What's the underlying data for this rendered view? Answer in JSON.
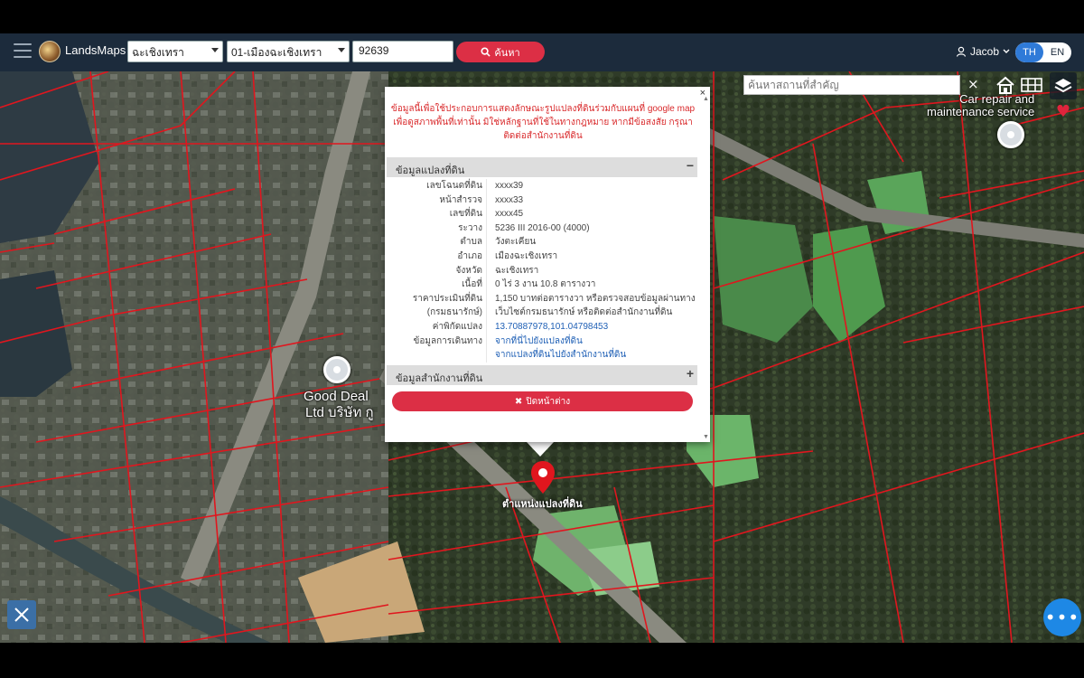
{
  "header": {
    "brand": "LandsMaps",
    "province_select": "ฉะเชิงเทรา",
    "district_select": "01-เมืองฉะเชิงเทรา",
    "parcel_number": "92639",
    "search_label": "ค้นหา",
    "user_name": "Jacob",
    "lang_th": "TH",
    "lang_en": "EN"
  },
  "map": {
    "place_search_placeholder": "ค้นหาสถานที่สำคัญ",
    "poi_top_right": "Car repair and\nmaintenance service",
    "poi_left_line1": "Good Deal",
    "poi_left_line2": "Ltd บริษัท กู",
    "marker_label": "ตำแหน่งแปลงที่ดิน"
  },
  "popup": {
    "notice": "ข้อมูลนี้เพื่อใช้ประกอบการแสดงลักษณะรูปแปลงที่ดินร่วมกับแผนที่ google map เพื่อดูสภาพพื้นที่เท่านั้น มิใช่หลักฐานที่ใช้ในทางกฎหมาย หากมีข้อสงสัย กรุณาติดต่อสำนักงานที่ดิน",
    "section1_title": "ข้อมูลแปลงที่ดิน",
    "section1_sign": "−",
    "rows": [
      {
        "label": "เลขโฉนดที่ดิน",
        "value": "xxxx39",
        "link": false
      },
      {
        "label": "หน้าสำรวจ",
        "value": "xxxx33",
        "link": false
      },
      {
        "label": "เลขที่ดิน",
        "value": "xxxx45",
        "link": false
      },
      {
        "label": "ระวาง",
        "value": "5236 III 2016-00 (4000)",
        "link": false
      },
      {
        "label": "ตำบล",
        "value": "วังตะเคียน",
        "link": false
      },
      {
        "label": "อำเภอ",
        "value": "เมืองฉะเชิงเทรา",
        "link": false
      },
      {
        "label": "จังหวัด",
        "value": "ฉะเชิงเทรา",
        "link": false
      },
      {
        "label": "เนื้อที่",
        "value": "0 ไร่ 3 งาน 10.8 ตารางวา",
        "link": false
      },
      {
        "label": "ราคาประเมินที่ดิน",
        "value": "1,150 บาทต่อตารางวา หรือตรวจสอบข้อมูลผ่านทาง",
        "link": false
      },
      {
        "label": "(กรมธนารักษ์)",
        "value": "เว็บไซต์กรมธนารักษ์ หรือติดต่อสำนักงานที่ดิน",
        "link": false
      },
      {
        "label": "ค่าพิกัดแปลง",
        "value": "13.70887978,101.04798453",
        "link": true
      },
      {
        "label": "ข้อมูลการเดินทาง",
        "value": "จากที่นี่ไปยังแปลงที่ดิน",
        "link": true
      },
      {
        "label": "",
        "value": "จากแปลงที่ดินไปยังสำนักงานที่ดิน",
        "link": true
      }
    ],
    "section2_title": "ข้อมูลสำนักงานที่ดิน",
    "section2_sign": "+",
    "close_window_label": "ปิดหน้าต่าง",
    "close_x": "×"
  }
}
